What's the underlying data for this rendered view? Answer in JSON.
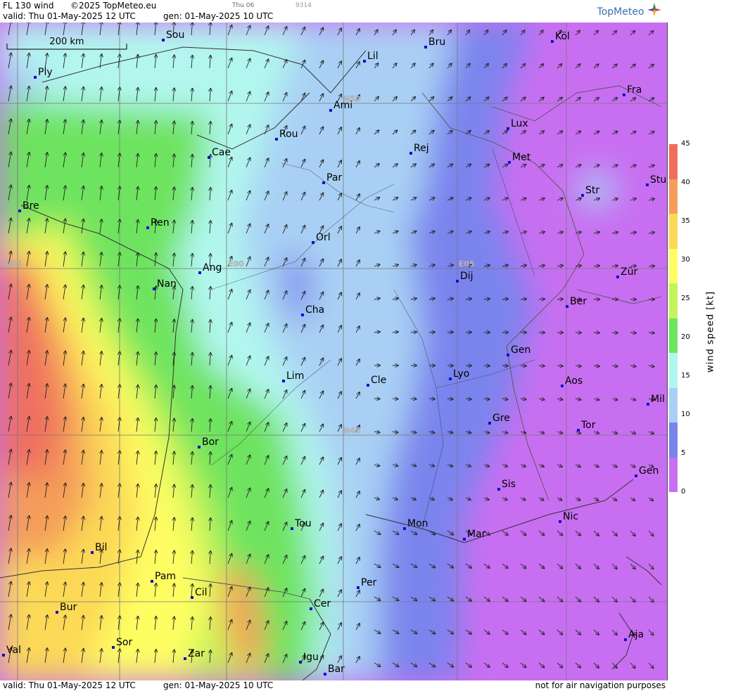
{
  "header": {
    "product": "FL 130 wind",
    "copyright": "©2025 TopMeteo.eu",
    "day": "Thu 06",
    "code": "9314",
    "valid": "valid:  Thu  01-May-2025  12 UTC",
    "gen": "gen:  01-May-2025 10 UTC",
    "brand": "TopMeteo"
  },
  "scale_label": "200 km",
  "grid_labels": [
    "N50",
    "N45",
    "W05",
    "E00",
    "E05"
  ],
  "cities": [
    {
      "name": "Sou"
    },
    {
      "name": "Ply"
    },
    {
      "name": "Lil"
    },
    {
      "name": "Bru"
    },
    {
      "name": "Köl"
    },
    {
      "name": "Ami"
    },
    {
      "name": "Fra"
    },
    {
      "name": "Rou"
    },
    {
      "name": "Lux"
    },
    {
      "name": "Cae"
    },
    {
      "name": "Rej"
    },
    {
      "name": "Met"
    },
    {
      "name": "Par"
    },
    {
      "name": "Str"
    },
    {
      "name": "Stu"
    },
    {
      "name": "Bre"
    },
    {
      "name": "Ren"
    },
    {
      "name": "Orl"
    },
    {
      "name": "Ang"
    },
    {
      "name": "Nan"
    },
    {
      "name": "Dij"
    },
    {
      "name": "Zür"
    },
    {
      "name": "Cha"
    },
    {
      "name": "Ber"
    },
    {
      "name": "Gen"
    },
    {
      "name": "Lim"
    },
    {
      "name": "Cle"
    },
    {
      "name": "Lyo"
    },
    {
      "name": "Aos"
    },
    {
      "name": "Mil"
    },
    {
      "name": "Gre"
    },
    {
      "name": "Tor"
    },
    {
      "name": "Bor"
    },
    {
      "name": "Sis"
    },
    {
      "name": "Gen"
    },
    {
      "name": "Tou"
    },
    {
      "name": "Mon"
    },
    {
      "name": "Nic"
    },
    {
      "name": "Mar"
    },
    {
      "name": "Bil"
    },
    {
      "name": "Pam"
    },
    {
      "name": "Cil"
    },
    {
      "name": "Per"
    },
    {
      "name": "Cer"
    },
    {
      "name": "Bur"
    },
    {
      "name": "Sor"
    },
    {
      "name": "Val"
    },
    {
      "name": "Zar"
    },
    {
      "name": "Igu"
    },
    {
      "name": "Bar"
    },
    {
      "name": "Aja"
    }
  ],
  "legend": {
    "title": "wind speed [kt]",
    "ticks": [
      "45",
      "40",
      "35",
      "30",
      "25",
      "20",
      "15",
      "10",
      "5",
      "0"
    ],
    "colors": [
      "#ef6f5f",
      "#f59d5a",
      "#fcd957",
      "#fefe64",
      "#c3f45a",
      "#6ee35e",
      "#b2f7ef",
      "#a9d0f4",
      "#7a84ed",
      "#c86ff1"
    ]
  },
  "footer": {
    "valid": "valid:  Thu  01-May-2025  12 UTC",
    "gen": "gen:  01-May-2025 10 UTC",
    "note": "not for air navigation purposes"
  }
}
